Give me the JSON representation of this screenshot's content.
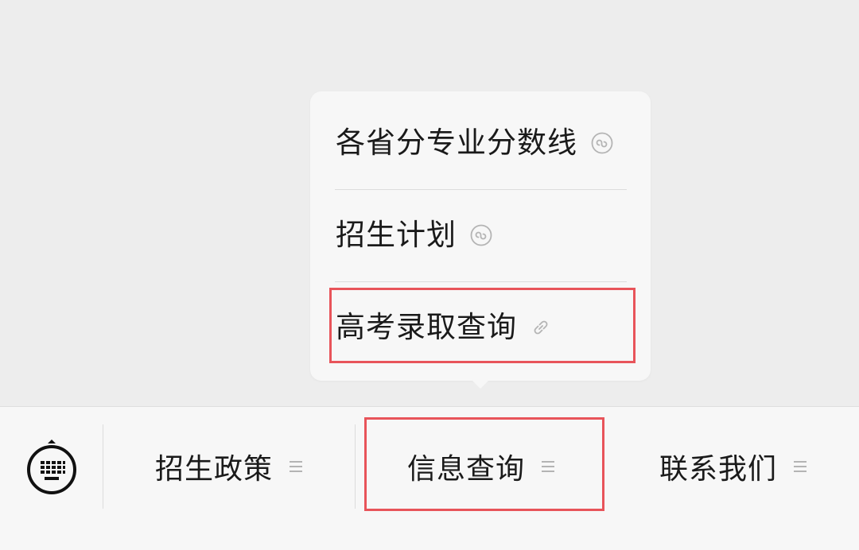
{
  "menu": {
    "items": [
      {
        "label": "各省分专业分数线",
        "icon": "mini-program-icon"
      },
      {
        "label": "招生计划",
        "icon": "mini-program-icon"
      },
      {
        "label": "高考录取查询",
        "icon": "link-icon"
      }
    ]
  },
  "bottom_bar": {
    "keyboard_icon": "keyboard-icon",
    "tabs": [
      {
        "label": "招生政策",
        "icon": "menu-icon"
      },
      {
        "label": "信息查询",
        "icon": "menu-icon"
      },
      {
        "label": "联系我们",
        "icon": "menu-icon"
      }
    ]
  },
  "colors": {
    "background": "#ededed",
    "panel": "#f7f7f7",
    "highlight": "#e8545a",
    "text": "#1a1a1a",
    "icon_gray": "#b4b4b4"
  }
}
